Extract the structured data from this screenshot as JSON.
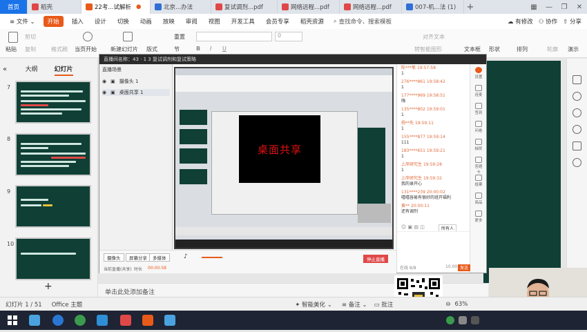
{
  "tabs": {
    "home": "首页",
    "items": [
      {
        "label": "稻壳",
        "color": "#e04848"
      },
      {
        "label": "22考...试解析",
        "color": "#e85a1a",
        "active": true
      },
      {
        "label": "北京...办法",
        "color": "#2f6fd6"
      },
      {
        "label": "复试调剂...pdf",
        "color": "#e04848"
      },
      {
        "label": "网络远程...pdf",
        "color": "#e04848"
      },
      {
        "label": "网络远程...pdf",
        "color": "#e04848"
      },
      {
        "label": "007-机...法 (1)",
        "color": "#2f6fd6"
      }
    ],
    "plus": "+"
  },
  "menu": {
    "file": "文件",
    "items": [
      "开始",
      "插入",
      "设计",
      "切换",
      "动画",
      "放映",
      "审阅",
      "视图",
      "开发工具",
      "会员专享",
      "稻壳资源"
    ],
    "search": "查找命令、搜索模板",
    "right": [
      "有修改",
      "协作",
      "分享"
    ]
  },
  "ribbon": {
    "paste": "粘贴",
    "cut": "剪切",
    "copy": "复制",
    "format": "格式刷",
    "play_current": "当页开始",
    "new_slide": "新建幻灯片",
    "layout": "版式",
    "section": "节",
    "reset": "重置",
    "text_box": "文本框",
    "shape": "形状",
    "arrange": "排列",
    "outline": "轮廓",
    "play": "演示",
    "font_size": "0",
    "text_align": "对齐文本",
    "convert": "转智能图形"
  },
  "leftpanel": {
    "tab_outline": "大纲",
    "tab_slides": "幻灯片",
    "slides": [
      {
        "num": "7"
      },
      {
        "num": "8"
      },
      {
        "num": "9"
      },
      {
        "num": "10"
      }
    ],
    "add": "+"
  },
  "meeting": {
    "title": "直播间名称：43 · 1 3 复试调剂和复试策略",
    "source_header": "直播场景",
    "sources": [
      "摄像头 1",
      "桌面共享 1"
    ],
    "share_label": "桌面共享",
    "buttons": [
      "摄像头",
      "屏幕分享",
      "多媒体"
    ],
    "status_prefix": "当前直播(共享)",
    "status_label": "时长",
    "timer": "00:00:58",
    "end_button": "停止直播"
  },
  "chat": {
    "messages": [
      {
        "name": "陈***笔",
        "time": "19:57:58",
        "text": "1"
      },
      {
        "name": "276****861",
        "time": "19:58:42",
        "text": "1"
      },
      {
        "name": "177****969",
        "time": "19:58:51",
        "text": "嗨"
      },
      {
        "name": "135****802",
        "time": "19:59:01",
        "text": "1"
      },
      {
        "name": "杨**先",
        "time": "19:59:11",
        "text": "1"
      },
      {
        "name": "155****877",
        "time": "19:59:14",
        "text": "111"
      },
      {
        "name": "183****651",
        "time": "19:59:21",
        "text": "1"
      },
      {
        "name": "上岸研究生",
        "time": "19:59:28",
        "text": "1"
      },
      {
        "name": "上岸研究生",
        "time": "19:59:32",
        "text": "我的录开心"
      },
      {
        "name": "131****239",
        "time": "20:00:02",
        "text": "嘻嘻容易有很好的班开福利"
      },
      {
        "name": "黄**",
        "time": "20:00:11",
        "text": "还有调剂"
      }
    ],
    "input_placeholder": "所有人",
    "footer_left": "在线 8/8",
    "footer_right": "10.00 %",
    "send": "发送",
    "tools": [
      "设置",
      "连麦",
      "签到",
      "问卷",
      "抽奖",
      "答题卡",
      "投票",
      "商品",
      "更多"
    ]
  },
  "notes": "单击此处添加备注",
  "status": {
    "slide_info": "幻灯片 1 / 51",
    "theme": "Office 主题",
    "beautify": "智能美化",
    "notes": "备注",
    "comments": "批注",
    "zoom": "63%"
  },
  "colors": {
    "accent": "#e85a1a",
    "slide_green": "#0f3f35",
    "taskbar": "#1e2433"
  }
}
